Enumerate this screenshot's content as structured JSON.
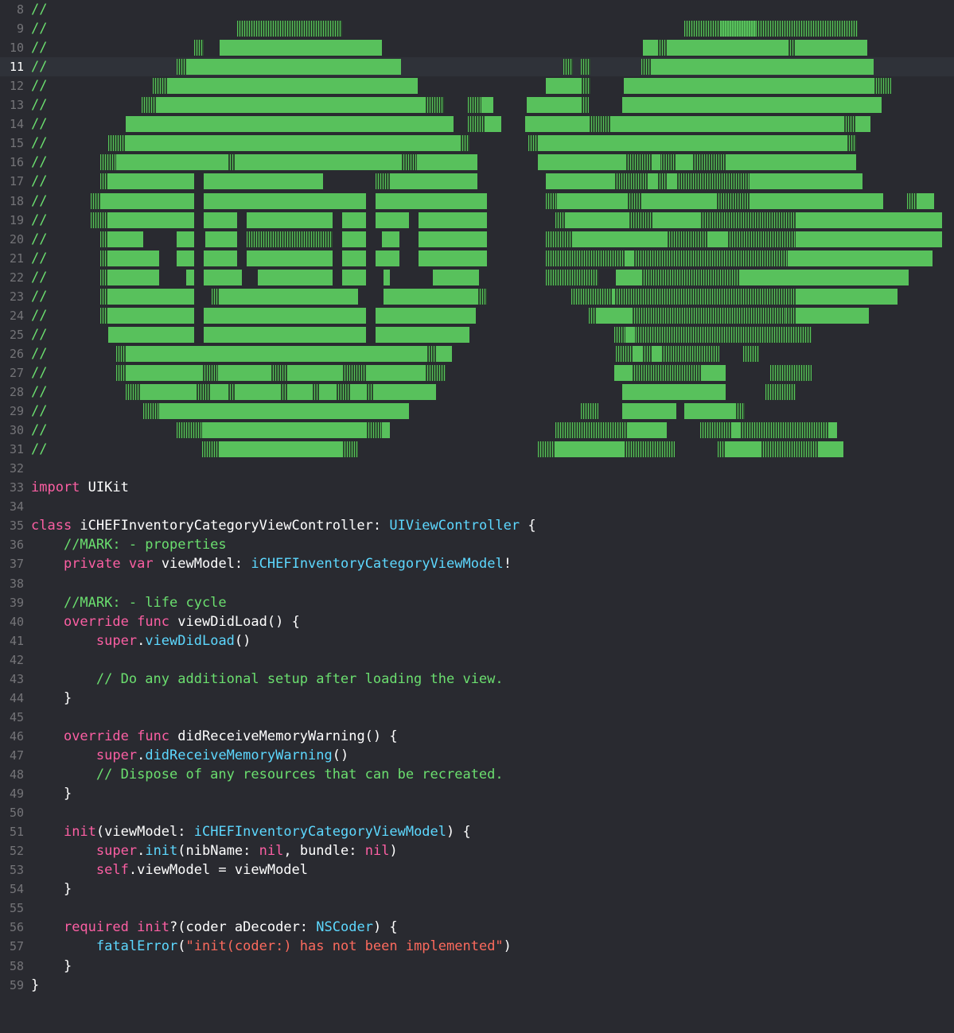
{
  "editor": {
    "current_line": "11",
    "colors": {
      "background": "#292a30",
      "comment": "#6bdf6f",
      "keyword": "#fc5fa3",
      "type": "#5dd8ff",
      "string": "#fc6a5d",
      "line_number": "#747478",
      "ascii_art_green": "#58c15c"
    },
    "lines": [
      {
        "num": "8",
        "tokens": [
          {
            "t": "//",
            "c": "com"
          }
        ]
      },
      {
        "num": "9",
        "tokens": [
          {
            "t": "//",
            "c": "com"
          }
        ]
      },
      {
        "num": "10",
        "tokens": [
          {
            "t": "//",
            "c": "com"
          }
        ]
      },
      {
        "num": "11",
        "tokens": [
          {
            "t": "//",
            "c": "com"
          }
        ]
      },
      {
        "num": "12",
        "tokens": [
          {
            "t": "//",
            "c": "com"
          }
        ]
      },
      {
        "num": "13",
        "tokens": [
          {
            "t": "//",
            "c": "com"
          }
        ]
      },
      {
        "num": "14",
        "tokens": [
          {
            "t": "//",
            "c": "com"
          }
        ]
      },
      {
        "num": "15",
        "tokens": [
          {
            "t": "//",
            "c": "com"
          }
        ]
      },
      {
        "num": "16",
        "tokens": [
          {
            "t": "//",
            "c": "com"
          }
        ]
      },
      {
        "num": "17",
        "tokens": [
          {
            "t": "//",
            "c": "com"
          }
        ]
      },
      {
        "num": "18",
        "tokens": [
          {
            "t": "//",
            "c": "com"
          }
        ]
      },
      {
        "num": "19",
        "tokens": [
          {
            "t": "//",
            "c": "com"
          }
        ]
      },
      {
        "num": "20",
        "tokens": [
          {
            "t": "//",
            "c": "com"
          }
        ]
      },
      {
        "num": "21",
        "tokens": [
          {
            "t": "//",
            "c": "com"
          }
        ]
      },
      {
        "num": "22",
        "tokens": [
          {
            "t": "//",
            "c": "com"
          }
        ]
      },
      {
        "num": "23",
        "tokens": [
          {
            "t": "//",
            "c": "com"
          }
        ]
      },
      {
        "num": "24",
        "tokens": [
          {
            "t": "//",
            "c": "com"
          }
        ]
      },
      {
        "num": "25",
        "tokens": [
          {
            "t": "//",
            "c": "com"
          }
        ]
      },
      {
        "num": "26",
        "tokens": [
          {
            "t": "//",
            "c": "com"
          }
        ]
      },
      {
        "num": "27",
        "tokens": [
          {
            "t": "//",
            "c": "com"
          }
        ]
      },
      {
        "num": "28",
        "tokens": [
          {
            "t": "//",
            "c": "com"
          }
        ]
      },
      {
        "num": "29",
        "tokens": [
          {
            "t": "//",
            "c": "com"
          }
        ]
      },
      {
        "num": "30",
        "tokens": [
          {
            "t": "//",
            "c": "com"
          }
        ]
      },
      {
        "num": "31",
        "tokens": [
          {
            "t": "//",
            "c": "com"
          }
        ]
      },
      {
        "num": "32",
        "tokens": []
      },
      {
        "num": "33",
        "tokens": [
          {
            "t": "import",
            "c": "kw"
          },
          {
            "t": " UIKit",
            "c": "plain"
          }
        ]
      },
      {
        "num": "34",
        "tokens": []
      },
      {
        "num": "35",
        "tokens": [
          {
            "t": "class",
            "c": "kw"
          },
          {
            "t": " iCHEFInventoryCategoryViewController: ",
            "c": "plain"
          },
          {
            "t": "UIViewController",
            "c": "type"
          },
          {
            "t": " {",
            "c": "plain"
          }
        ]
      },
      {
        "num": "36",
        "tokens": [
          {
            "t": "    ",
            "c": "plain"
          },
          {
            "t": "//MARK: - properties",
            "c": "com"
          }
        ]
      },
      {
        "num": "37",
        "tokens": [
          {
            "t": "    ",
            "c": "plain"
          },
          {
            "t": "private",
            "c": "kw"
          },
          {
            "t": " ",
            "c": "plain"
          },
          {
            "t": "var",
            "c": "kw"
          },
          {
            "t": " viewModel: ",
            "c": "plain"
          },
          {
            "t": "iCHEFInventoryCategoryViewModel",
            "c": "type"
          },
          {
            "t": "!",
            "c": "plain"
          }
        ]
      },
      {
        "num": "38",
        "tokens": []
      },
      {
        "num": "39",
        "tokens": [
          {
            "t": "    ",
            "c": "plain"
          },
          {
            "t": "//MARK: - life cycle",
            "c": "com"
          }
        ]
      },
      {
        "num": "40",
        "tokens": [
          {
            "t": "    ",
            "c": "plain"
          },
          {
            "t": "override",
            "c": "kw"
          },
          {
            "t": " ",
            "c": "plain"
          },
          {
            "t": "func",
            "c": "kw"
          },
          {
            "t": " viewDidLoad() {",
            "c": "plain"
          }
        ]
      },
      {
        "num": "41",
        "tokens": [
          {
            "t": "        ",
            "c": "plain"
          },
          {
            "t": "super",
            "c": "kw"
          },
          {
            "t": ".",
            "c": "plain"
          },
          {
            "t": "viewDidLoad",
            "c": "type"
          },
          {
            "t": "()",
            "c": "plain"
          }
        ]
      },
      {
        "num": "42",
        "tokens": []
      },
      {
        "num": "43",
        "tokens": [
          {
            "t": "        ",
            "c": "plain"
          },
          {
            "t": "// Do any additional setup after loading the view.",
            "c": "com"
          }
        ]
      },
      {
        "num": "44",
        "tokens": [
          {
            "t": "    }",
            "c": "plain"
          }
        ]
      },
      {
        "num": "45",
        "tokens": []
      },
      {
        "num": "46",
        "tokens": [
          {
            "t": "    ",
            "c": "plain"
          },
          {
            "t": "override",
            "c": "kw"
          },
          {
            "t": " ",
            "c": "plain"
          },
          {
            "t": "func",
            "c": "kw"
          },
          {
            "t": " didReceiveMemoryWarning() {",
            "c": "plain"
          }
        ]
      },
      {
        "num": "47",
        "tokens": [
          {
            "t": "        ",
            "c": "plain"
          },
          {
            "t": "super",
            "c": "kw"
          },
          {
            "t": ".",
            "c": "plain"
          },
          {
            "t": "didReceiveMemoryWarning",
            "c": "type"
          },
          {
            "t": "()",
            "c": "plain"
          }
        ]
      },
      {
        "num": "48",
        "tokens": [
          {
            "t": "        ",
            "c": "plain"
          },
          {
            "t": "// Dispose of any resources that can be recreated.",
            "c": "com"
          }
        ]
      },
      {
        "num": "49",
        "tokens": [
          {
            "t": "    }",
            "c": "plain"
          }
        ]
      },
      {
        "num": "50",
        "tokens": []
      },
      {
        "num": "51",
        "tokens": [
          {
            "t": "    ",
            "c": "plain"
          },
          {
            "t": "init",
            "c": "kw"
          },
          {
            "t": "(viewModel: ",
            "c": "plain"
          },
          {
            "t": "iCHEFInventoryCategoryViewModel",
            "c": "type"
          },
          {
            "t": ") {",
            "c": "plain"
          }
        ]
      },
      {
        "num": "52",
        "tokens": [
          {
            "t": "        ",
            "c": "plain"
          },
          {
            "t": "super",
            "c": "kw"
          },
          {
            "t": ".",
            "c": "plain"
          },
          {
            "t": "init",
            "c": "type"
          },
          {
            "t": "(nibName: ",
            "c": "plain"
          },
          {
            "t": "nil",
            "c": "kw"
          },
          {
            "t": ", bundle: ",
            "c": "plain"
          },
          {
            "t": "nil",
            "c": "kw"
          },
          {
            "t": ")",
            "c": "plain"
          }
        ]
      },
      {
        "num": "53",
        "tokens": [
          {
            "t": "        ",
            "c": "plain"
          },
          {
            "t": "self",
            "c": "kw"
          },
          {
            "t": ".viewModel = viewModel",
            "c": "plain"
          }
        ]
      },
      {
        "num": "54",
        "tokens": [
          {
            "t": "    }",
            "c": "plain"
          }
        ]
      },
      {
        "num": "55",
        "tokens": []
      },
      {
        "num": "56",
        "tokens": [
          {
            "t": "    ",
            "c": "plain"
          },
          {
            "t": "required",
            "c": "kw"
          },
          {
            "t": " ",
            "c": "plain"
          },
          {
            "t": "init",
            "c": "kw"
          },
          {
            "t": "?(coder aDecoder: ",
            "c": "plain"
          },
          {
            "t": "NSCoder",
            "c": "type"
          },
          {
            "t": ") {",
            "c": "plain"
          }
        ]
      },
      {
        "num": "57",
        "tokens": [
          {
            "t": "        ",
            "c": "plain"
          },
          {
            "t": "fatalError",
            "c": "type"
          },
          {
            "t": "(",
            "c": "plain"
          },
          {
            "t": "\"init(coder:) has not been implemented\"",
            "c": "str"
          },
          {
            "t": ")",
            "c": "plain"
          }
        ]
      },
      {
        "num": "58",
        "tokens": [
          {
            "t": "    }",
            "c": "plain"
          }
        ]
      },
      {
        "num": "59",
        "tokens": [
          {
            "t": "}",
            "c": "plain"
          }
        ]
      }
    ]
  }
}
